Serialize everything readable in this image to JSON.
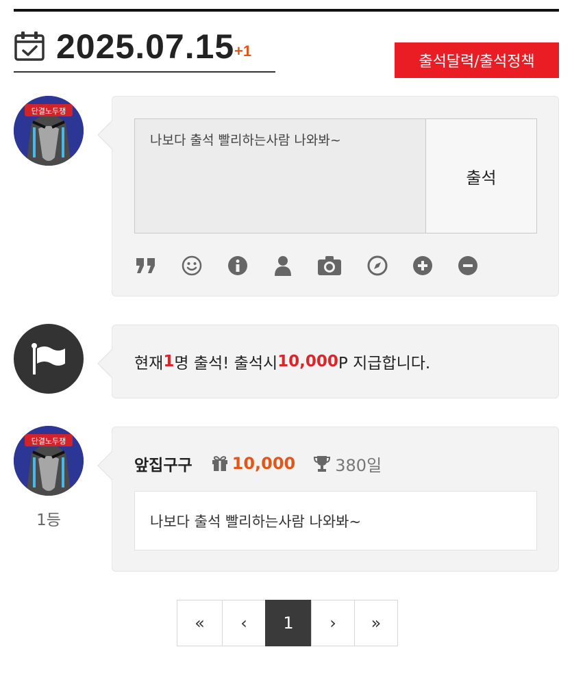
{
  "header": {
    "date": "2025.07.15",
    "increment": "+1",
    "policy_button": "출석달력/출석정책"
  },
  "compose": {
    "memo_text": "나보다 출석 빨리하는사람 나와봐~",
    "checkin_button": "출석",
    "toolbar_icons": [
      "quote-icon",
      "smile-icon",
      "info-icon",
      "user-icon",
      "camera-icon",
      "compass-icon",
      "plus-icon",
      "minus-icon"
    ]
  },
  "notice": {
    "prefix": "현재 ",
    "count": "1",
    "mid": "명 출석! 출석시 ",
    "points": "10,000",
    "suffix": "P 지급합니다."
  },
  "entry": {
    "name": "앞집구구",
    "points": "10,000",
    "days": "380일",
    "message": "나보다 출석 빨리하는사람 나와봐~",
    "rank": "1등",
    "avatar_text": "단결노두쟁"
  },
  "pagination": {
    "first": "«",
    "prev": "‹",
    "current": "1",
    "next": "›",
    "last": "»"
  },
  "colors": {
    "accent_red": "#ea1c24",
    "points_orange": "#e2561b",
    "highlight_red": "#d9262a"
  }
}
